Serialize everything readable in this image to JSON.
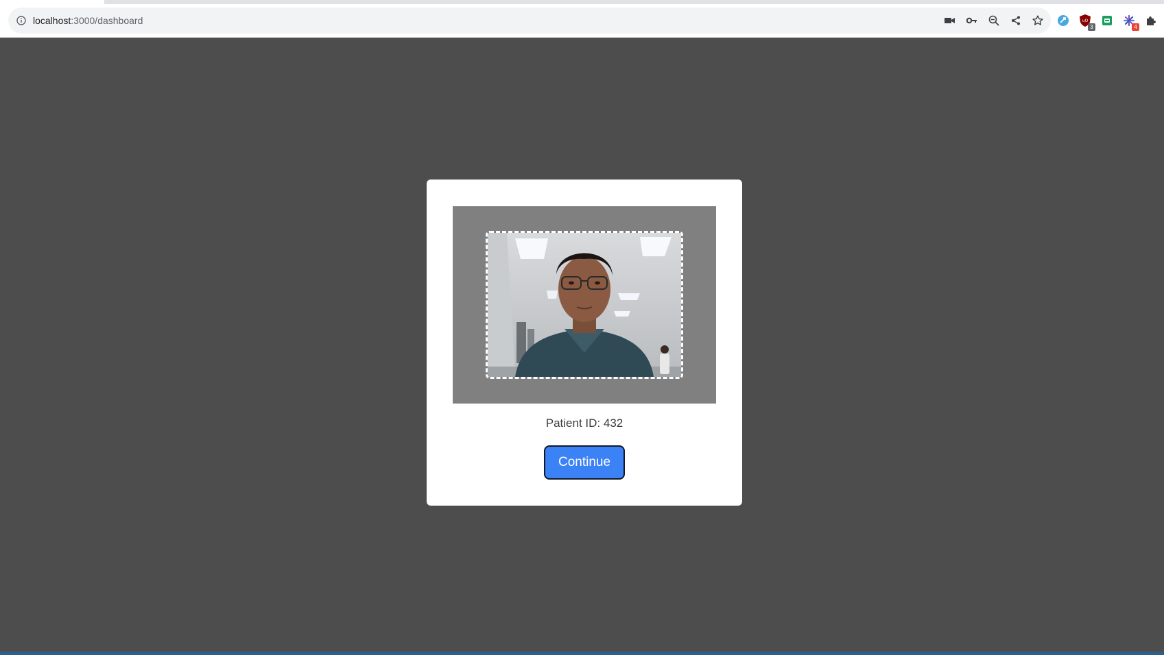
{
  "browser": {
    "url_host": "localhost",
    "url_path": ":3000/dashboard",
    "icons": [
      "info-icon",
      "camera-icon",
      "key-icon",
      "zoom-out-icon",
      "share-icon",
      "bookmark-star-icon"
    ],
    "extensions": [
      {
        "name": "blue-extension-icon",
        "color": "#4aa8e0",
        "badge": ""
      },
      {
        "name": "ublock-extension-icon",
        "color": "#8b0000",
        "badge": "3",
        "badge_color": "#5f6368"
      },
      {
        "name": "green-extension-icon",
        "color": "#17a05d",
        "badge": ""
      },
      {
        "name": "multicolor-extension-icon",
        "color": "#6a5acd",
        "badge": "4",
        "badge_color": "#ea4335"
      },
      {
        "name": "puzzle-extensions-icon",
        "color": "#5f6368",
        "badge": ""
      }
    ]
  },
  "page": {
    "background_color": "#4d4d4d",
    "patient_label": "Patient ID: 432",
    "continue_label": "Continue",
    "accent_color": "#3b82f6"
  }
}
